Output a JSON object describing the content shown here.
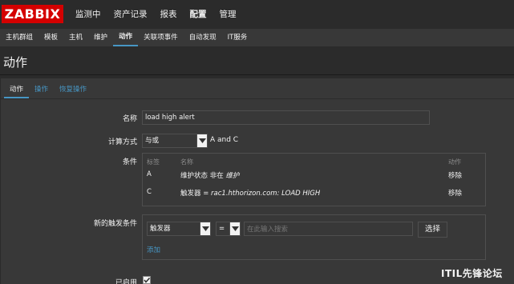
{
  "logo": "ZABBIX",
  "main_nav": [
    "监测中",
    "资产记录",
    "报表",
    "配置",
    "管理"
  ],
  "sub_nav": [
    "主机群组",
    "模板",
    "主机",
    "维护",
    "动作",
    "关联项事件",
    "自动发现",
    "IT服务"
  ],
  "page_title": "动作",
  "tabs": [
    "动作",
    "操作",
    "恢复操作"
  ],
  "form": {
    "name_label": "名称",
    "name_value": "load high alert",
    "calc_label": "计算方式",
    "calc_value": "与或",
    "calc_text": "A and C",
    "conditions_label": "条件",
    "conditions_headers": {
      "label": "标签",
      "name": "名称",
      "action": "动作"
    },
    "conditions": [
      {
        "label": "A",
        "name_prefix": "维护状态 非在 ",
        "name_value": "维护",
        "action": "移除"
      },
      {
        "label": "C",
        "name_prefix": "触发器 = ",
        "name_value": "rac1.hthorizon.com: LOAD HIGH",
        "action": "移除"
      }
    ],
    "new_trigger_label": "新的触发条件",
    "new_trigger_type": "触发器",
    "new_trigger_op": "=",
    "search_placeholder": "在此输入搜索",
    "select_button": "选择",
    "add_link": "添加",
    "enabled_label": "已启用",
    "enabled": true
  },
  "watermark": "ITIL先锋论坛",
  "colors": {
    "accent": "#4796c4",
    "logo": "#d40000",
    "background": "#2b2b2b",
    "panel": "#383838"
  }
}
